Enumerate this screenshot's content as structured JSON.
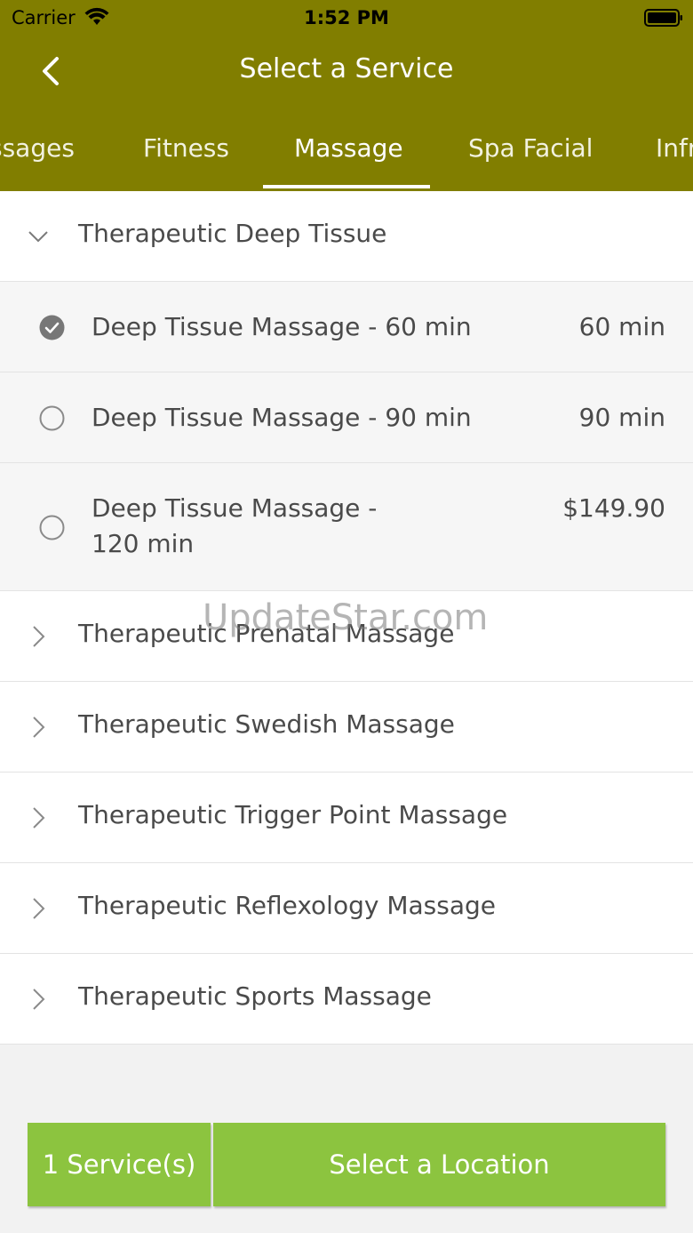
{
  "status_bar": {
    "carrier": "Carrier",
    "time": "1:52 PM"
  },
  "nav": {
    "title": "Select a Service"
  },
  "tabs": [
    {
      "label": "ssages"
    },
    {
      "label": "Fitness"
    },
    {
      "label": "Massage",
      "selected": true
    },
    {
      "label": "Spa Facial"
    },
    {
      "label": "Infr"
    }
  ],
  "groups": {
    "deep_tissue": {
      "label": "Therapeutic Deep Tissue",
      "expanded": true
    },
    "prenatal": {
      "label": "Therapeutic Prenatal Massage"
    },
    "swedish": {
      "label": "Therapeutic Swedish Massage"
    },
    "trigger_point": {
      "label": "Therapeutic Trigger Point Massage"
    },
    "reflexology": {
      "label": "Therapeutic Reflexology Massage"
    },
    "sports": {
      "label": "Therapeutic Sports Massage"
    }
  },
  "services": [
    {
      "name": "Deep Tissue Massage - 60 min",
      "right": "60 min",
      "selected": true
    },
    {
      "name": "Deep Tissue Massage - 90 min",
      "right": "90 min",
      "selected": false
    },
    {
      "name": "Deep Tissue Massage - 120 min",
      "right": "$149.90",
      "selected": false
    }
  ],
  "watermark": "UpdateStar.com",
  "footer": {
    "count_label": "1 Service(s)",
    "action_label": "Select a Location"
  },
  "colors": {
    "header": "#817e00",
    "button": "#8cc43f"
  }
}
